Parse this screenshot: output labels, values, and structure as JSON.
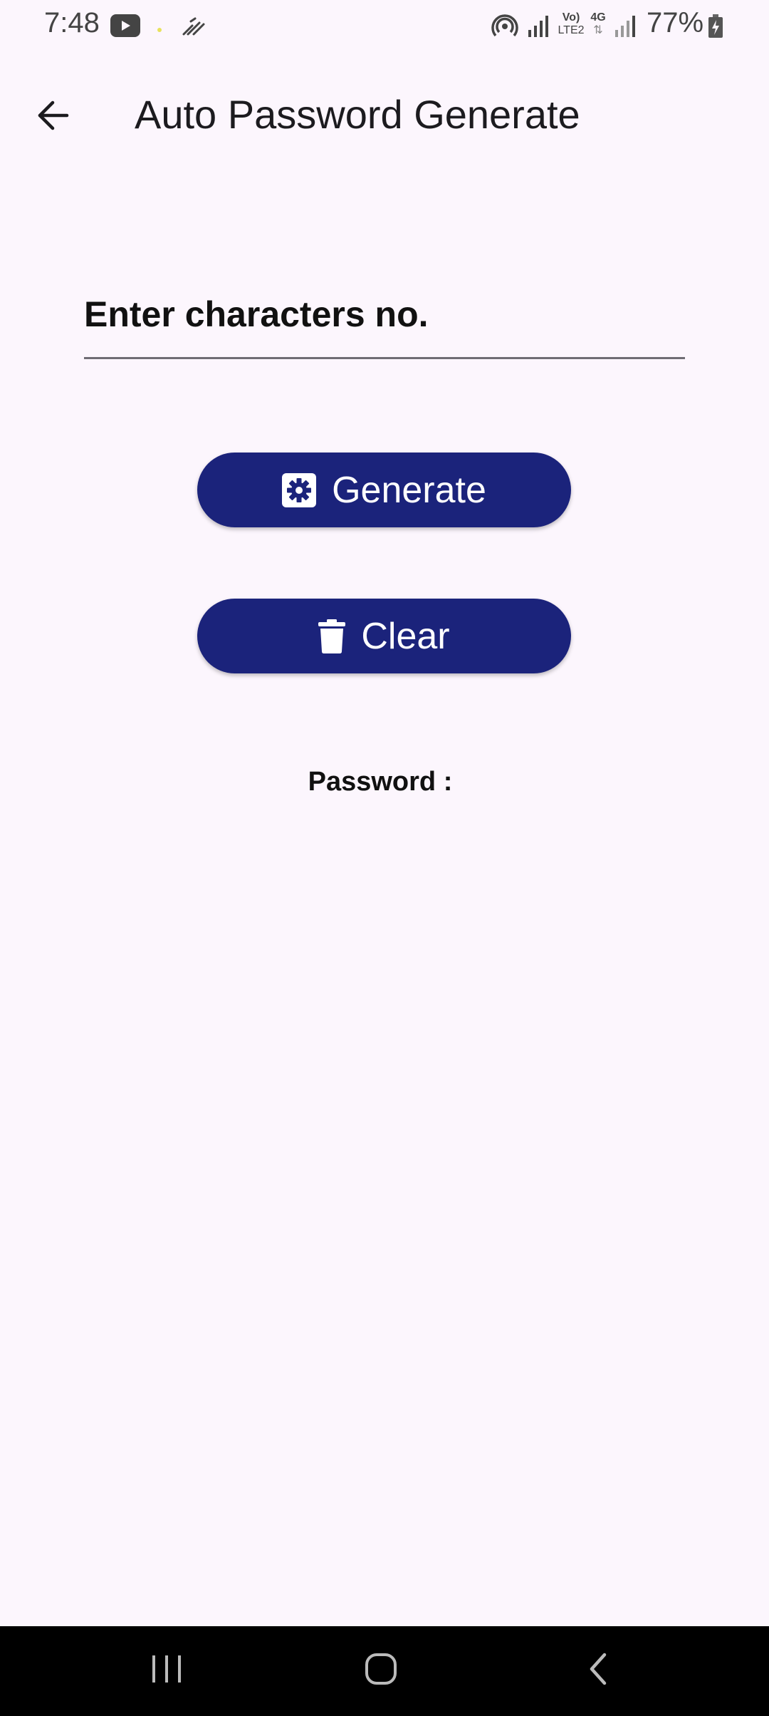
{
  "status_bar": {
    "time": "7:48",
    "battery": "77%",
    "network_label_top": "Vo)",
    "network_label_bottom": "LTE2",
    "network_type": "4G",
    "icons": [
      "youtube-icon",
      "notification-dot-icon",
      "stylus-icon",
      "hotspot-icon",
      "signal-icon",
      "volte-icon",
      "mobile-data-icon",
      "signal-icon",
      "battery-charging-icon"
    ]
  },
  "app_bar": {
    "title": "Auto Password Generate",
    "back_icon": "arrow-back-icon"
  },
  "form": {
    "input_placeholder": "Enter characters no.",
    "input_value": ""
  },
  "buttons": {
    "generate_label": "Generate",
    "generate_icon": "gear-icon",
    "clear_label": "Clear",
    "clear_icon": "trash-icon"
  },
  "result": {
    "password_label": "Password :"
  },
  "nav_bar": {
    "items": [
      "recent-apps-icon",
      "home-icon",
      "back-icon"
    ]
  },
  "colors": {
    "background": "#fcf6fd",
    "button": "#1b237b",
    "button_text": "#ffffff",
    "nav_bar": "#000000"
  }
}
